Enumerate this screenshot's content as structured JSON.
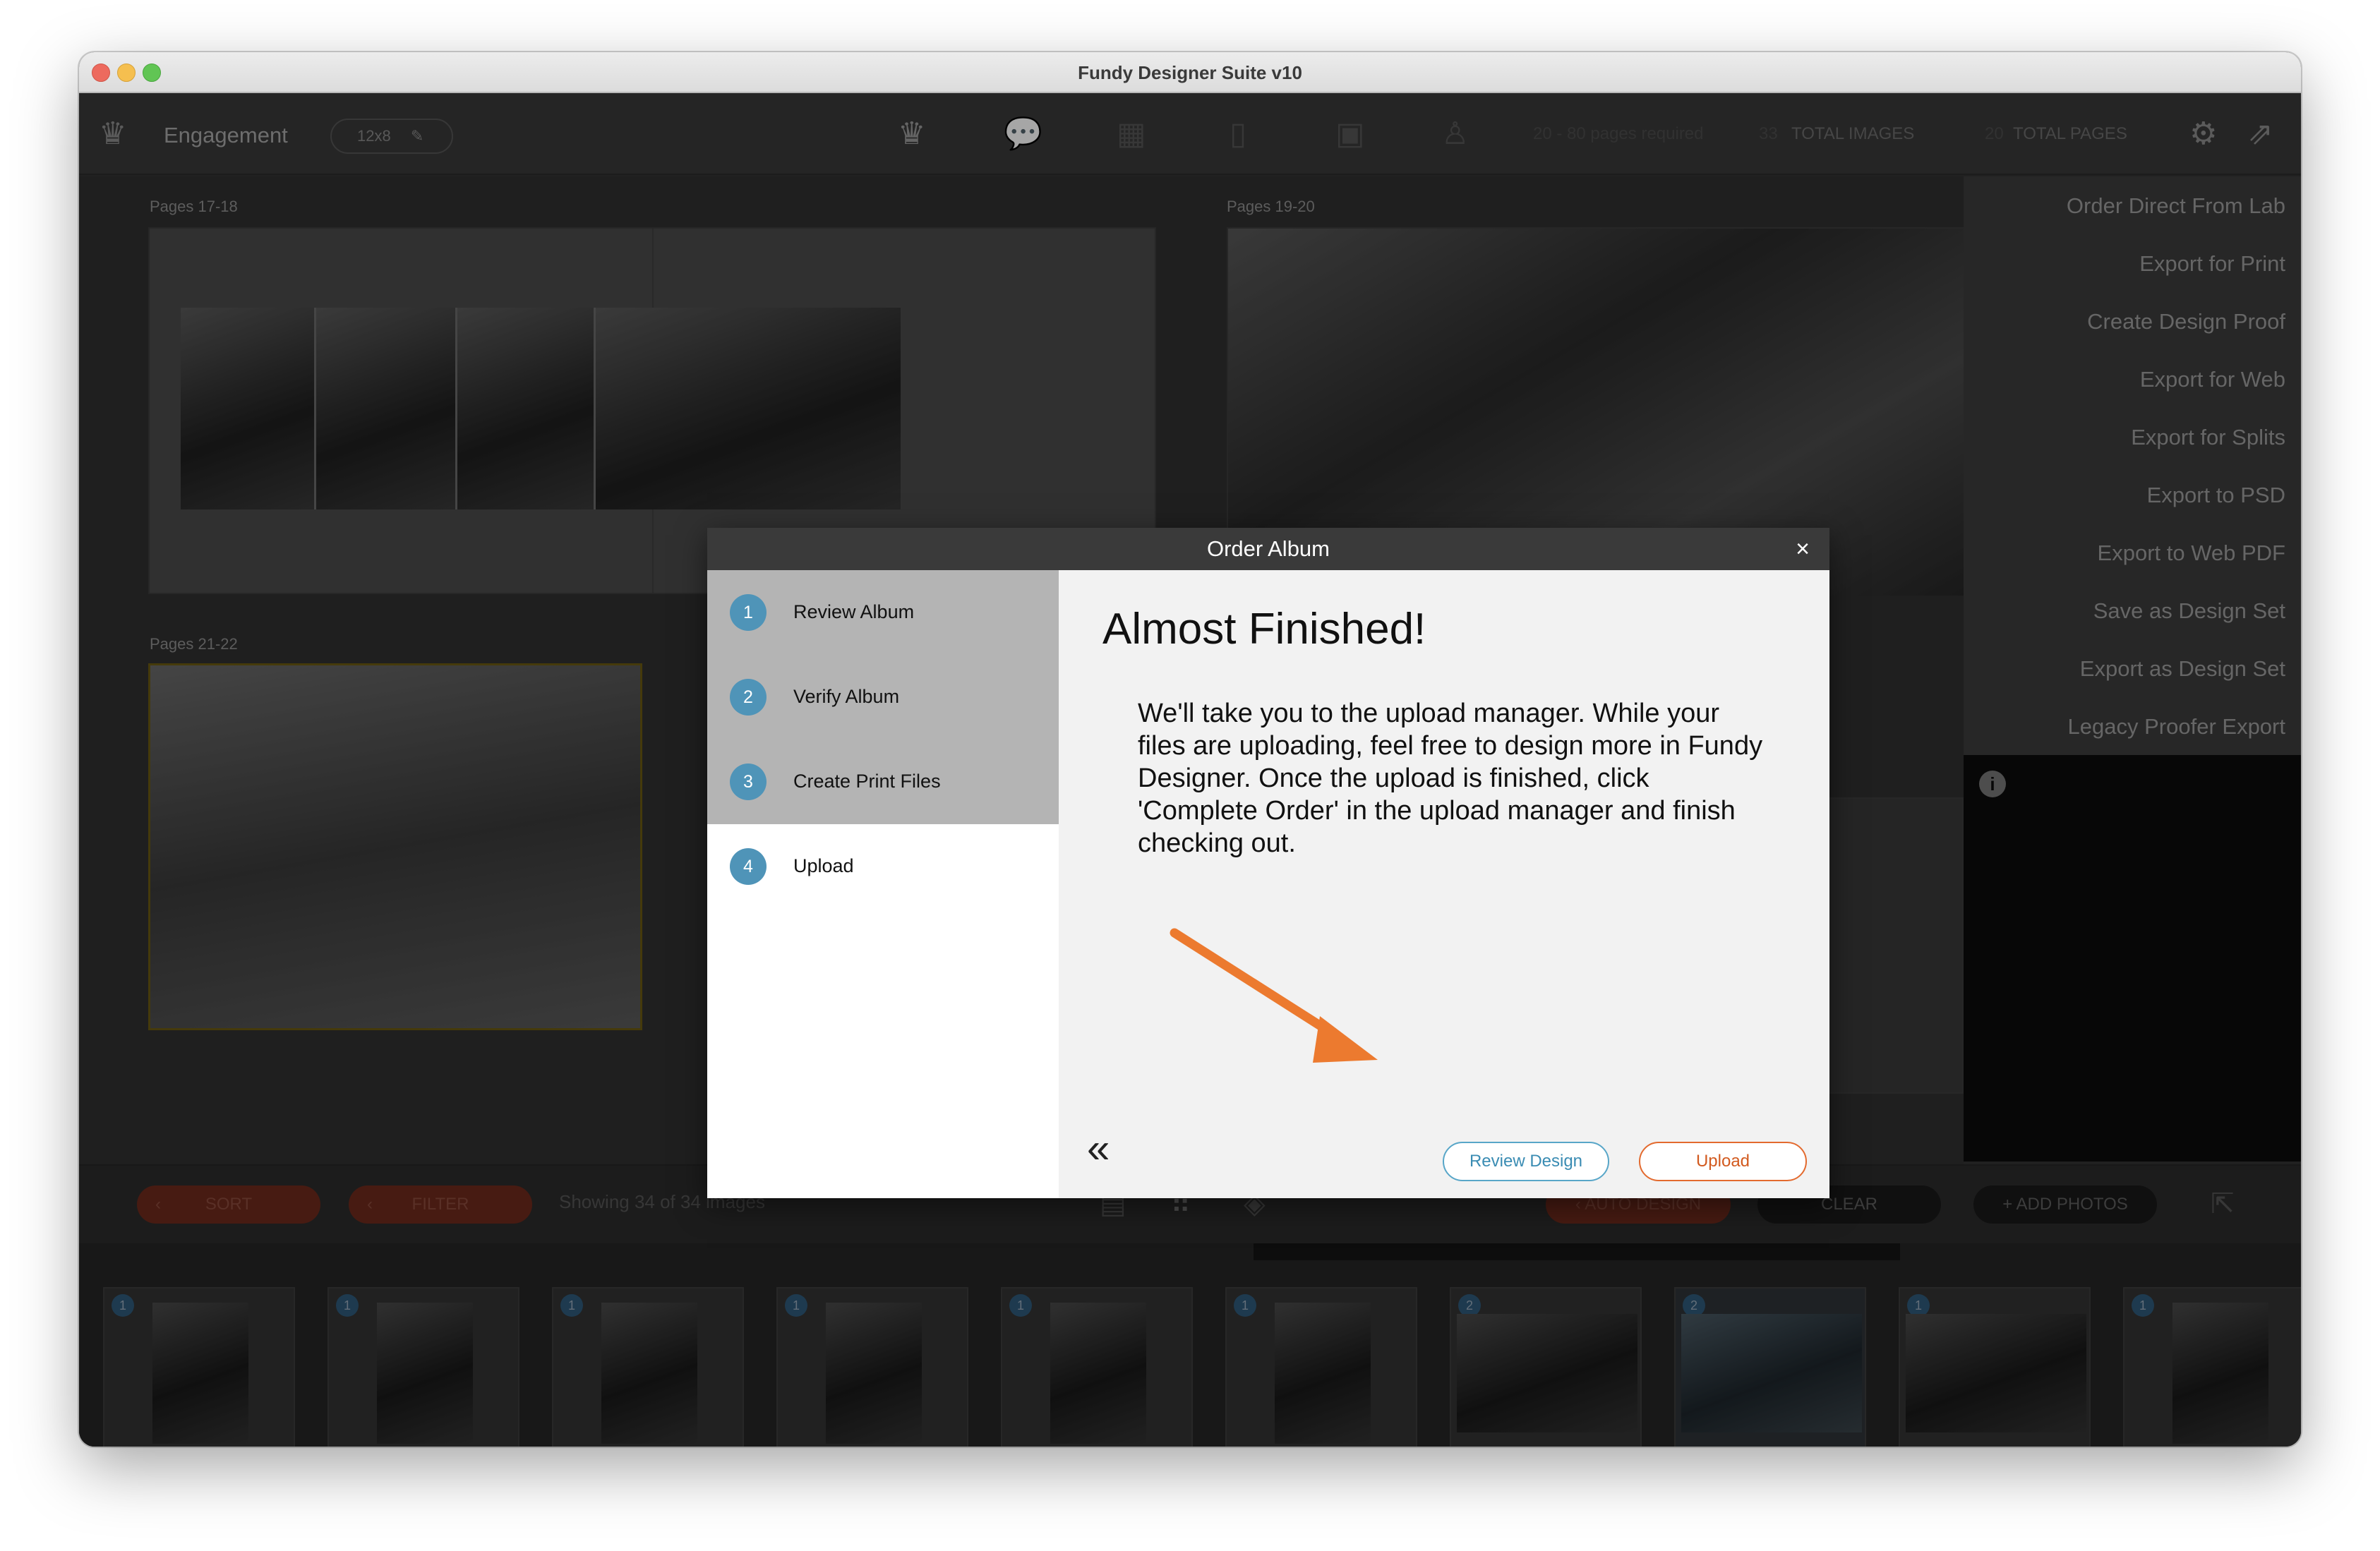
{
  "window": {
    "title": "Fundy Designer Suite v10"
  },
  "toolbar": {
    "project_name": "Engagement",
    "album_size": "12x8",
    "pages_required": "20 - 80 pages required",
    "total_images_count": "33",
    "total_images_label": "TOTAL IMAGES",
    "total_pages_count": "20",
    "total_pages_label": "TOTAL PAGES"
  },
  "canvas": {
    "spreads": [
      {
        "label": "Pages 17-18"
      },
      {
        "label": "Pages 19-20"
      },
      {
        "label": "Pages 21-22"
      }
    ]
  },
  "side_menu": {
    "items": [
      "Order Direct From Lab",
      "Export for Print",
      "Create Design Proof",
      "Export for Web",
      "Export for Splits",
      "Export to PSD",
      "Export to Web PDF",
      "Save as Design Set",
      "Export as Design Set",
      "Legacy Proofer Export"
    ]
  },
  "bottom_bar": {
    "sort_label": "SORT",
    "filter_label": "FILTER",
    "showing_text": "Showing 34 of 34 images",
    "auto_design_label": "AUTO DESIGN",
    "clear_label": "CLEAR",
    "add_photos_label": "+ ADD PHOTOS"
  },
  "filmstrip": {
    "thumbnails": [
      {
        "badge": "1"
      },
      {
        "badge": "1"
      },
      {
        "badge": "1"
      },
      {
        "badge": "1"
      },
      {
        "badge": "1"
      },
      {
        "badge": "1"
      },
      {
        "badge": "2"
      },
      {
        "badge": "2"
      },
      {
        "badge": "1"
      },
      {
        "badge": "1"
      }
    ],
    "stars": "☆☆☆☆☆",
    "heart": "♡"
  },
  "dialog": {
    "title": "Order Album",
    "close_glyph": "×",
    "steps": [
      {
        "number": "1",
        "label": "Review Album",
        "state": "done"
      },
      {
        "number": "2",
        "label": "Verify Album",
        "state": "done"
      },
      {
        "number": "3",
        "label": "Create Print Files",
        "state": "done"
      },
      {
        "number": "4",
        "label": "Upload",
        "state": "current"
      }
    ],
    "heading": "Almost Finished!",
    "body": "We'll take you to the upload manager. While your files are uploading, feel free to design more in Fundy Designer. Once the upload is finished, click 'Complete Order' in the upload manager and finish checking out.",
    "back_glyph": "«",
    "review_design_label": "Review Design",
    "upload_label": "Upload"
  },
  "colors": {
    "accent_blue": "#4f94b8",
    "accent_orange": "#e36a2e",
    "annotation_arrow": "#ec7a2f"
  },
  "icons": {
    "close": "close-icon",
    "back": "double-chevron-left-icon",
    "info": "info-icon"
  }
}
